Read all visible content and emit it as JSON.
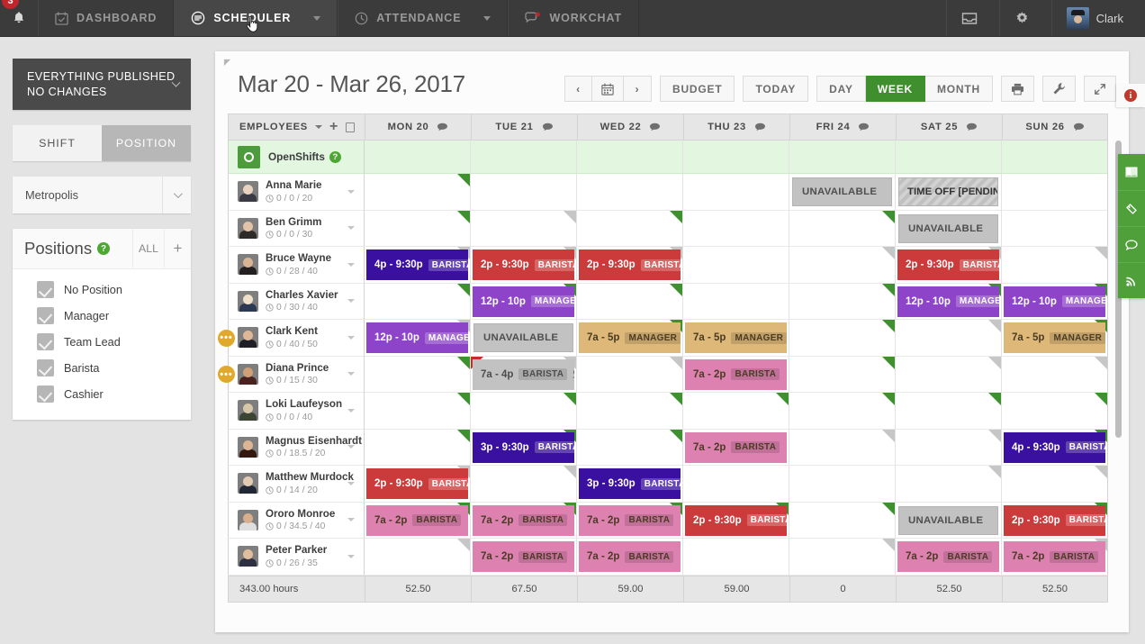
{
  "topnav": {
    "badge_count": "3",
    "bell_icon": "bell-icon",
    "items": [
      {
        "label": "DASHBOARD",
        "icon": "calendar-check-icon",
        "active": false,
        "caret": false
      },
      {
        "label": "SCHEDULER",
        "icon": "scheduler-icon",
        "active": true,
        "caret": true
      },
      {
        "label": "ATTENDANCE",
        "icon": "clock-icon",
        "active": false,
        "caret": true
      },
      {
        "label": "WORKCHAT",
        "icon": "chat-dot-icon",
        "active": false,
        "caret": false
      }
    ],
    "inbox_icon": "inbox-icon",
    "gear_icon": "gear-icon",
    "user_name": "Clark"
  },
  "sidebar": {
    "publish": {
      "line1": "EVERYTHING PUBLISHED",
      "line2": "NO CHANGES"
    },
    "segmented": [
      {
        "label": "SHIFT",
        "active": false
      },
      {
        "label": "POSITION",
        "active": true
      }
    ],
    "location": "Metropolis",
    "positions_title": "Positions",
    "positions_all": "ALL",
    "positions_add": "+",
    "positions": [
      {
        "label": "No Position",
        "checked": true
      },
      {
        "label": "Manager",
        "checked": true
      },
      {
        "label": "Team Lead",
        "checked": true
      },
      {
        "label": "Barista",
        "checked": true
      },
      {
        "label": "Cashier",
        "checked": true
      }
    ]
  },
  "main": {
    "title": "Mar 20 - Mar 26, 2017",
    "nav_prev": "‹",
    "nav_next": "›",
    "calendar_icon": "calendar-icon",
    "budget": "BUDGET",
    "today": "TODAY",
    "views": [
      {
        "label": "DAY",
        "active": false
      },
      {
        "label": "WEEK",
        "active": true
      },
      {
        "label": "MONTH",
        "active": false
      }
    ],
    "print_icon": "printer-icon",
    "tools_icon": "wrench-icon",
    "expand_icon": "expand-icon",
    "employees_header": "EMPLOYEES",
    "open_shifts_label": "OpenShifts",
    "days": [
      {
        "label": "MON 20"
      },
      {
        "label": "TUE 21"
      },
      {
        "label": "WED 22"
      },
      {
        "label": "THU 23"
      },
      {
        "label": "FRI 24"
      },
      {
        "label": "SAT 25"
      },
      {
        "label": "SUN 26"
      }
    ],
    "totals_label": "343.00 hours",
    "totals": [
      "52.50",
      "67.50",
      "59.00",
      "59.00",
      "0",
      "52.50",
      "52.50"
    ],
    "rail": [
      "book-icon",
      "ticket-icon",
      "chat-icon",
      "rss-icon"
    ],
    "info_icon": "info-icon"
  },
  "colors": {
    "brand_green": "#4c9c3c",
    "purple": "#8e44c8",
    "indigo": "#3a10a0",
    "red": "#cc3b3b",
    "pink": "#dd81b0",
    "tan": "#ddb878",
    "grey": "#c2c2c2",
    "accent_yellow": "#e0a92b"
  },
  "rows": [
    {
      "name": "Anna Marie",
      "hours": "0 / 0 / 20",
      "face": "#e8d3c0",
      "body": "#3a3a44",
      "flag": "",
      "cells": [
        {
          "corner": "green"
        },
        {
          "corner": ""
        },
        {
          "corner": ""
        },
        {
          "corner": ""
        },
        {
          "type": "unavailable",
          "text": "UNAVAILABLE"
        },
        {
          "type": "timeoff",
          "text": "TIME OFF [PENDING]"
        },
        {
          "corner": ""
        }
      ]
    },
    {
      "name": "Ben Grimm",
      "hours": "0 / 0 / 30",
      "face": "#e2c3a8",
      "body": "#2e2a28",
      "flag": "",
      "cells": [
        {
          "corner": "green"
        },
        {
          "corner": "grey"
        },
        {
          "corner": "green"
        },
        {
          "corner": ""
        },
        {
          "corner": "green"
        },
        {
          "type": "unavailable",
          "text": "UNAVAILABLE"
        },
        {
          "corner": ""
        }
      ]
    },
    {
      "name": "Bruce Wayne",
      "hours": "0 / 28 / 40",
      "face": "#d9b493",
      "body": "#23201f",
      "flag": "",
      "cells": [
        {
          "type": "shift",
          "time": "4p - 9:30p",
          "pos": "BARISTA",
          "color": "#3a10a0",
          "corner": "grey"
        },
        {
          "type": "shift",
          "time": "2p - 9:30p",
          "pos": "BARISTA",
          "color": "#cc3b3b",
          "corner": "grey"
        },
        {
          "type": "shift",
          "time": "2p - 9:30p",
          "pos": "BARISTA",
          "color": "#cc3b3b",
          "corner": "grey"
        },
        {
          "corner": ""
        },
        {
          "corner": "grey"
        },
        {
          "type": "shift",
          "time": "2p - 9:30p",
          "pos": "BARISTA",
          "color": "#cc3b3b",
          "corner": "grey"
        },
        {
          "corner": "grey"
        }
      ]
    },
    {
      "name": "Charles Xavier",
      "hours": "0 / 30 / 40",
      "face": "#efe0cc",
      "body": "#2b3a52",
      "flag": "",
      "cells": [
        {
          "corner": "green"
        },
        {
          "type": "shift",
          "time": "12p - 10p",
          "pos": "MANAGER",
          "color": "#8e44c8",
          "corner": "green"
        },
        {
          "corner": "green"
        },
        {
          "corner": ""
        },
        {
          "corner": "green"
        },
        {
          "type": "shift",
          "time": "12p - 10p",
          "pos": "MANAGER",
          "color": "#8e44c8",
          "corner": "green"
        },
        {
          "type": "shift",
          "time": "12p - 10p",
          "pos": "MANAGER",
          "color": "#8e44c8",
          "corner": "green"
        }
      ]
    },
    {
      "name": "Clark Kent",
      "hours": "0 / 40 / 50",
      "face": "#dcb896",
      "body": "#1f1f28",
      "flag": "•••",
      "cells": [
        {
          "type": "shift",
          "time": "12p - 10p",
          "pos": "MANAGER",
          "color": "#8e44c8",
          "corner": "grey"
        },
        {
          "type": "unavailable",
          "text": "UNAVAILABLE"
        },
        {
          "type": "shift",
          "time": "7a - 5p",
          "pos": "MANAGER",
          "color": "#ddb878",
          "dark": true,
          "corner": "green"
        },
        {
          "type": "shift",
          "time": "7a - 5p",
          "pos": "MANAGER",
          "color": "#ddb878",
          "dark": true,
          "corner": ""
        },
        {
          "corner": "green"
        },
        {
          "corner": "grey"
        },
        {
          "type": "shift",
          "time": "7a - 5p",
          "pos": "MANAGER",
          "color": "#ddb878",
          "dark": true,
          "corner": "green"
        }
      ]
    },
    {
      "name": "Diana Prince",
      "hours": "0 / 15 / 30",
      "face": "#cf9f78",
      "body": "#4a2320",
      "flag": "•••",
      "cells": [
        {
          "corner": "green"
        },
        {
          "type": "shift",
          "time": "7a - 4p",
          "pos": "BARISTA",
          "color": "#c2c2c2",
          "greyed": true,
          "corner": "grey",
          "red_corner": true,
          "bubble": true
        },
        {
          "corner": "grey"
        },
        {
          "type": "shift",
          "time": "7a - 2p",
          "pos": "BARISTA",
          "color": "#dd81b0",
          "dark": true,
          "corner": ""
        },
        {
          "corner": "green"
        },
        {
          "corner": "grey"
        },
        {
          "corner": "grey"
        }
      ]
    },
    {
      "name": "Loki Laufeyson",
      "hours": "0 / 0 / 40",
      "face": "#d6c7a8",
      "body": "#3c4434",
      "flag": "",
      "cells": [
        {
          "corner": "green"
        },
        {
          "corner": "green"
        },
        {
          "corner": "green"
        },
        {
          "corner": "green"
        },
        {
          "corner": "green"
        },
        {
          "corner": "green"
        },
        {
          "corner": "green"
        }
      ]
    },
    {
      "name": "Magnus Eisenhardt",
      "hours": "0 / 18.5 / 20",
      "face": "#dcb593",
      "body": "#34190f",
      "flag": "",
      "cells": [
        {
          "corner": "green"
        },
        {
          "type": "shift",
          "time": "3p - 9:30p",
          "pos": "BARISTA",
          "color": "#3a10a0",
          "corner": "green"
        },
        {
          "corner": "green"
        },
        {
          "type": "shift",
          "time": "7a - 2p",
          "pos": "BARISTA",
          "color": "#dd81b0",
          "dark": true,
          "corner": ""
        },
        {
          "corner": "grey"
        },
        {
          "corner": "grey"
        },
        {
          "type": "shift",
          "time": "4p - 9:30p",
          "pos": "BARISTA",
          "color": "#3a10a0",
          "corner": "green"
        }
      ]
    },
    {
      "name": "Matthew Murdock",
      "hours": "0 / 14 / 20",
      "face": "#e3cbb3",
      "body": "#222833",
      "flag": "",
      "cells": [
        {
          "type": "shift",
          "time": "2p - 9:30p",
          "pos": "BARISTA",
          "color": "#cc3b3b",
          "corner": "grey"
        },
        {
          "corner": "grey"
        },
        {
          "type": "shift",
          "time": "3p - 9:30p",
          "pos": "BARISTA",
          "color": "#3a10a0",
          "corner": ""
        },
        {
          "corner": ""
        },
        {
          "corner": ""
        },
        {
          "corner": "grey"
        },
        {
          "corner": "grey"
        }
      ]
    },
    {
      "name": "Ororo Monroe",
      "hours": "0 / 34.5 / 40",
      "face": "#d8ae8c",
      "body": "#dedede",
      "flag": "",
      "cells": [
        {
          "type": "shift",
          "time": "7a - 2p",
          "pos": "BARISTA",
          "color": "#dd81b0",
          "dark": true,
          "corner": "green"
        },
        {
          "type": "shift",
          "time": "7a - 2p",
          "pos": "BARISTA",
          "color": "#dd81b0",
          "dark": true,
          "corner": "green"
        },
        {
          "type": "shift",
          "time": "7a - 2p",
          "pos": "BARISTA",
          "color": "#dd81b0",
          "dark": true,
          "corner": "green"
        },
        {
          "type": "shift",
          "time": "2p - 9:30p",
          "pos": "BARISTA",
          "color": "#cc3b3b",
          "corner": "green"
        },
        {
          "corner": "green"
        },
        {
          "type": "unavailable",
          "text": "UNAVAILABLE"
        },
        {
          "type": "shift",
          "time": "2p - 9:30p",
          "pos": "BARISTA",
          "color": "#cc3b3b",
          "corner": "green"
        }
      ]
    },
    {
      "name": "Peter Parker",
      "hours": "0 / 26 / 35",
      "face": "#e0bd9c",
      "body": "#2c3040",
      "flag": "",
      "cells": [
        {
          "corner": "grey"
        },
        {
          "type": "shift",
          "time": "7a - 2p",
          "pos": "BARISTA",
          "color": "#dd81b0",
          "dark": true,
          "corner": ""
        },
        {
          "type": "shift",
          "time": "7a - 2p",
          "pos": "BARISTA",
          "color": "#dd81b0",
          "dark": true,
          "corner": ""
        },
        {
          "corner": ""
        },
        {
          "corner": "grey"
        },
        {
          "type": "shift",
          "time": "7a - 2p",
          "pos": "BARISTA",
          "color": "#dd81b0",
          "dark": true,
          "corner": ""
        },
        {
          "type": "shift",
          "time": "7a - 2p",
          "pos": "BARISTA",
          "color": "#dd81b0",
          "dark": true,
          "corner": "grey"
        }
      ]
    }
  ]
}
